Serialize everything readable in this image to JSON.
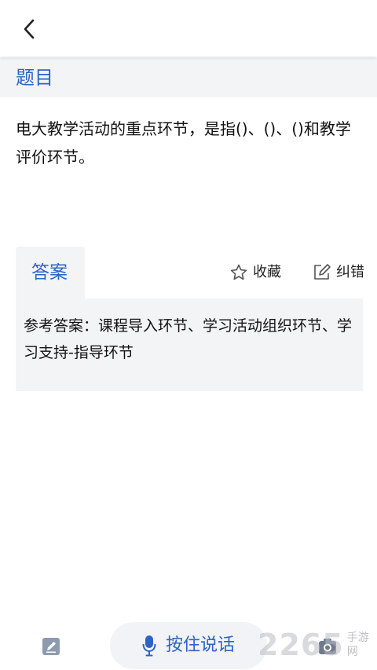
{
  "navbar": {
    "back_icon": "chevron-left-icon"
  },
  "question_section": {
    "title": "题目",
    "text": "电大教学活动的重点环节，是指()、()、()和教学评价环节。"
  },
  "answer_section": {
    "tab_label": "答案",
    "favorite_label": "收藏",
    "favorite_icon": "star-outline-icon",
    "report_label": "纠错",
    "report_icon": "edit-square-icon",
    "answer_text": "参考答案：课程导入环节、学习活动组织环节、学习支持-指导环节"
  },
  "bottom_bar": {
    "edit_icon": "pencil-note-icon",
    "voice_label": "按住说话",
    "voice_icon": "microphone-icon",
    "camera_icon": "camera-icon"
  },
  "watermark": {
    "number": "2265",
    "text": "手游网"
  },
  "colors": {
    "accent": "#2b63c9",
    "panel_bg": "#f3f4f6",
    "text": "#111111"
  }
}
